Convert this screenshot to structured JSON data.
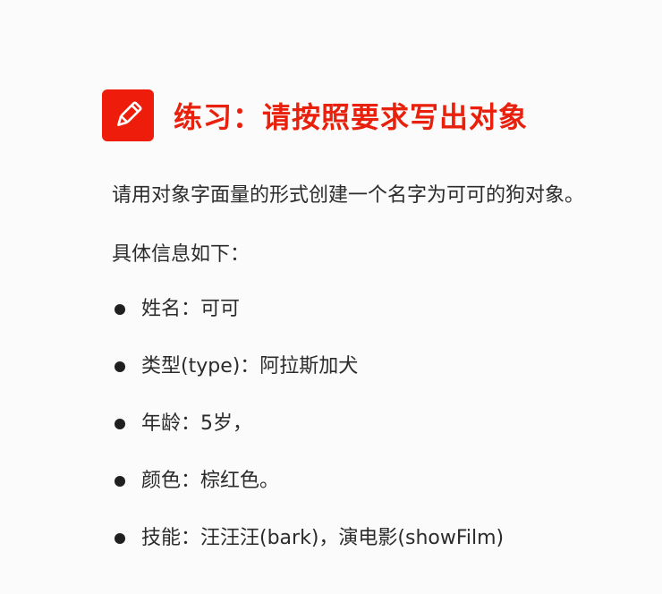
{
  "heading": {
    "icon": "pencil-icon",
    "title": "练习：请按照要求写出对象"
  },
  "intro": "请用对象字面量的形式创建一个名字为可可的狗对象。",
  "subheading": "具体信息如下：",
  "bullets": [
    {
      "text": "姓名：可可"
    },
    {
      "text": "类型(type)：阿拉斯加犬"
    },
    {
      "text": "年龄：5岁，"
    },
    {
      "text": "颜色：棕红色。"
    },
    {
      "text": "技能：汪汪汪(bark)，演电影(showFilm)"
    }
  ],
  "colors": {
    "accent": "#e8200c",
    "icon_bg": "#ee1d0b",
    "text": "#2b2b2b"
  }
}
